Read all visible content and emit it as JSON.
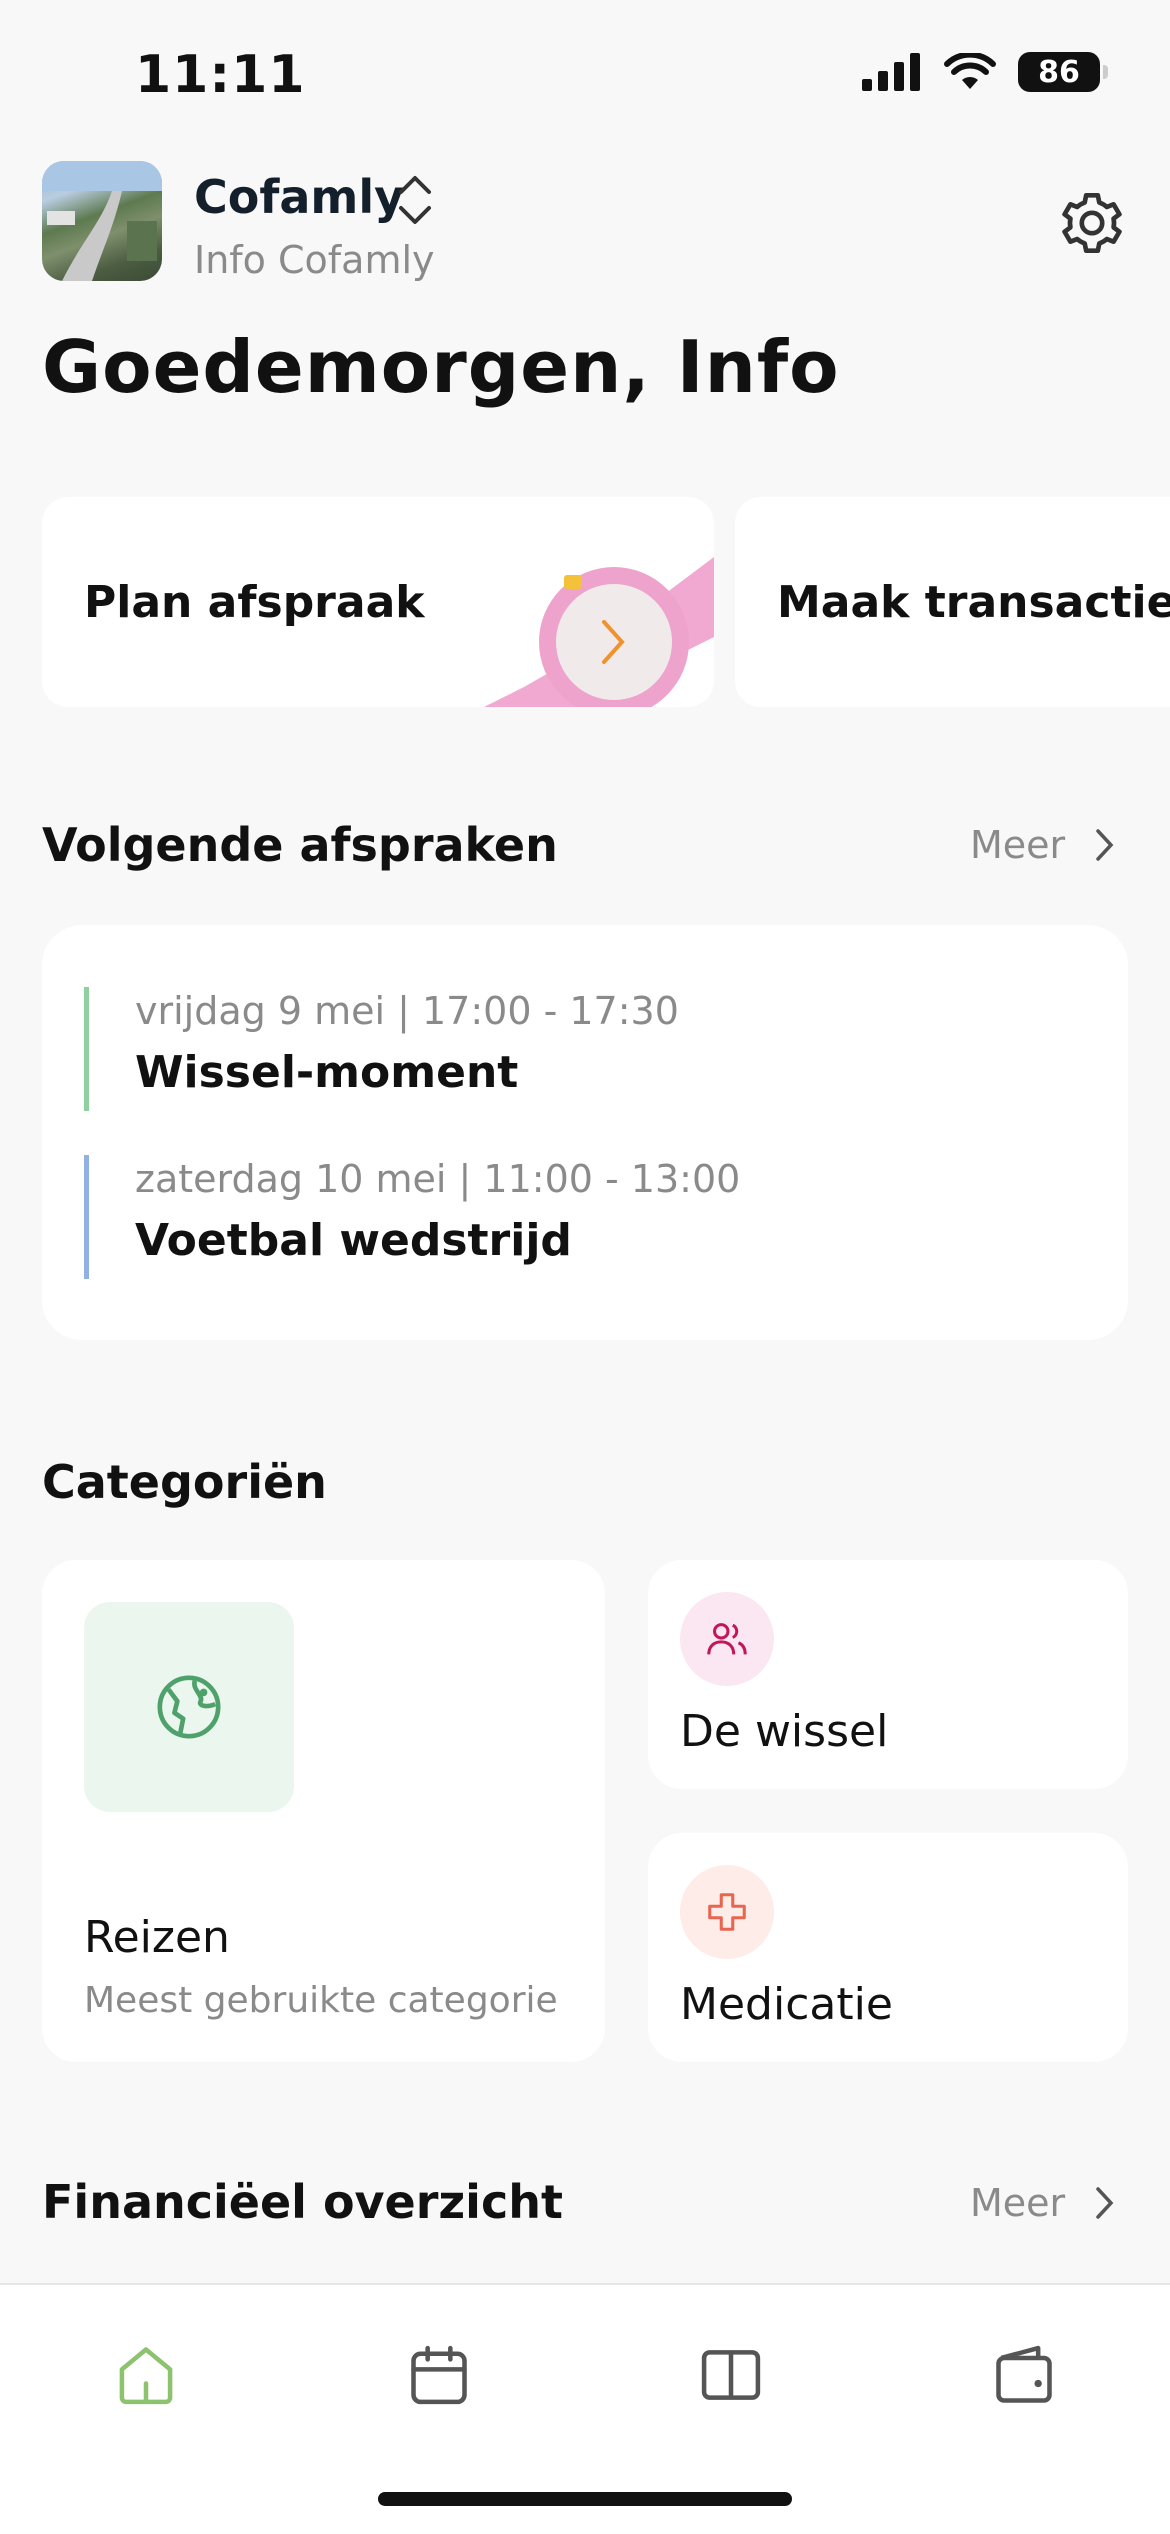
{
  "status_bar": {
    "time": "11:11",
    "battery": "86"
  },
  "header": {
    "app_name": "Cofamly",
    "account": "Info Cofamly"
  },
  "greeting": "Goedemorgen, Info",
  "actions": [
    {
      "label": "Plan afspraak"
    },
    {
      "label": "Maak transactie"
    }
  ],
  "appointments": {
    "title": "Volgende afspraken",
    "more_label": "Meer",
    "items": [
      {
        "when": "vrijdag 9 mei | 17:00 - 17:30",
        "title": "Wissel-moment",
        "color": "#8fd19e"
      },
      {
        "when": "zaterdag 10 mei | 11:00 - 13:00",
        "title": "Voetbal wedstrijd",
        "color": "#8fb1e3"
      }
    ]
  },
  "categories": {
    "title": "Categoriën",
    "featured": {
      "name": "Reizen",
      "subtitle": "Meest gebruikte categorie",
      "icon": "globe-icon"
    },
    "items": [
      {
        "name": "De wissel",
        "icon": "users-icon",
        "color": "#c2185b"
      },
      {
        "name": "Medicatie",
        "icon": "medical-cross-icon",
        "color": "#e8664f"
      }
    ]
  },
  "finance": {
    "title": "Financiëel overzicht",
    "more_label": "Meer"
  },
  "nav": [
    {
      "icon": "home-icon",
      "active": true
    },
    {
      "icon": "calendar-icon",
      "active": false
    },
    {
      "icon": "book-icon",
      "active": false
    },
    {
      "icon": "wallet-icon",
      "active": false
    }
  ],
  "colors": {
    "accent_green": "#8dc26f",
    "background": "#f8f8f8"
  }
}
